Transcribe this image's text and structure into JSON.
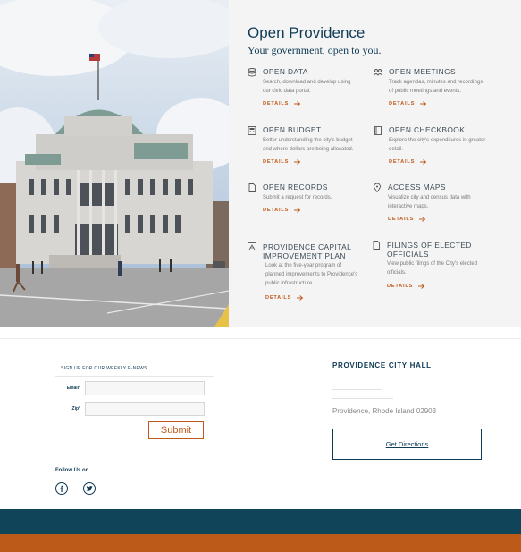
{
  "panel": {
    "title": "Open Providence",
    "subtitle": "Your government, open to you."
  },
  "items": [
    {
      "icon": "database-icon",
      "title": "OPEN DATA",
      "desc": [
        "Search, download and develop using",
        "our civic data portal."
      ],
      "link": "DETAILS"
    },
    {
      "icon": "people-icon",
      "title": "OPEN MEETINGS",
      "desc": [
        "Track agendas, minutes and recordings",
        "of public meetings and events."
      ],
      "link": "DETAILS"
    },
    {
      "icon": "calculator-icon",
      "title": "OPEN BUDGET",
      "desc": [
        "Better understanding the city's budget",
        "and where dollars are being allocated."
      ],
      "link": "DETAILS"
    },
    {
      "icon": "checkbook-icon",
      "title": "OPEN CHECKBOOK",
      "desc": [
        "Explore the city's expenditures in greater",
        "detail."
      ],
      "link": "DETAILS"
    },
    {
      "icon": "document-icon",
      "title": "OPEN RECORDS",
      "desc": [
        "Submit a request for records."
      ],
      "link": "DETAILS"
    },
    {
      "icon": "map-pin-icon",
      "title": "ACCESS MAPS",
      "desc": [
        "Visualize city and census data with",
        "interactive maps."
      ],
      "link": "DETAILS"
    },
    {
      "icon": "blueprint-icon",
      "title": "PROVIDENCE CAPITAL IMPROVEMENT PLAN",
      "desc": [
        "Look at the five-year program of",
        "planned improvements to Providence's",
        "public infrastructure."
      ],
      "link": "DETAILS"
    },
    {
      "icon": "filing-icon",
      "title": "FILINGS OF ELECTED OFFICIALS",
      "desc": [
        "View public filings of the City's elected",
        "officials."
      ],
      "link": "DETAILS"
    }
  ],
  "signup": {
    "title": "SIGN UP FOR OUR WEEKLY E-NEWS",
    "email_label": "Email*",
    "email_value": "",
    "zip_label": "Zip*",
    "zip_value": "",
    "submit_label": "Submit"
  },
  "social": {
    "label": "Follow Us on",
    "icons": [
      "facebook-icon",
      "twitter-icon"
    ]
  },
  "city_hall": {
    "title": "PROVIDENCE CITY HALL",
    "address": "Providence, Rhode Island 02903",
    "directions_label": "Get Directions"
  },
  "colors": {
    "navy": "#0f4459",
    "orange": "#bc5a1a",
    "accent_text": "#c05a1c",
    "heading": "#0f3b57"
  }
}
